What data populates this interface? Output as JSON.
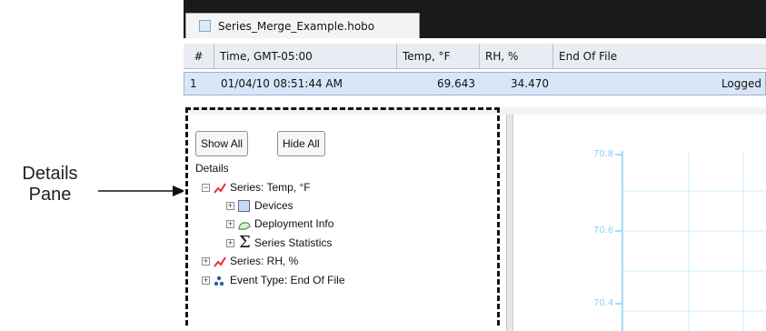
{
  "annotation": {
    "line1": "Details",
    "line2": "Pane"
  },
  "tab": {
    "label": "Series_Merge_Example.hobo"
  },
  "table": {
    "headers": [
      "#",
      "Time, GMT-05:00",
      "Temp, °F",
      "RH, %",
      "End Of File"
    ],
    "row": {
      "index": "1",
      "time": "01/04/10 08:51:44 AM",
      "temp": "69.643",
      "rh": "34.470",
      "status": "Logged"
    }
  },
  "details_pane": {
    "show_all": "Show All",
    "hide_all": "Hide All",
    "title": "Details",
    "tree": {
      "series_temp": "Series: Temp, °F",
      "devices": "Devices",
      "deployment": "Deployment Info",
      "stats": "Series Statistics",
      "series_rh": "Series: RH, %",
      "event_type": "Event Type: End Of File"
    }
  },
  "chart": {
    "ticks": [
      "70.8",
      "70.6",
      "70.4"
    ]
  },
  "icons": [
    "tab-file-icon",
    "series-line-icon",
    "device-icon",
    "deployment-icon",
    "sigma-icon",
    "event-icon",
    "expand-icon",
    "collapse-icon",
    "arrow-icon"
  ],
  "colors": {
    "series_line": "#e23333",
    "chart_axis": "#87d4f7",
    "selected_row": "#d9e6f7"
  }
}
